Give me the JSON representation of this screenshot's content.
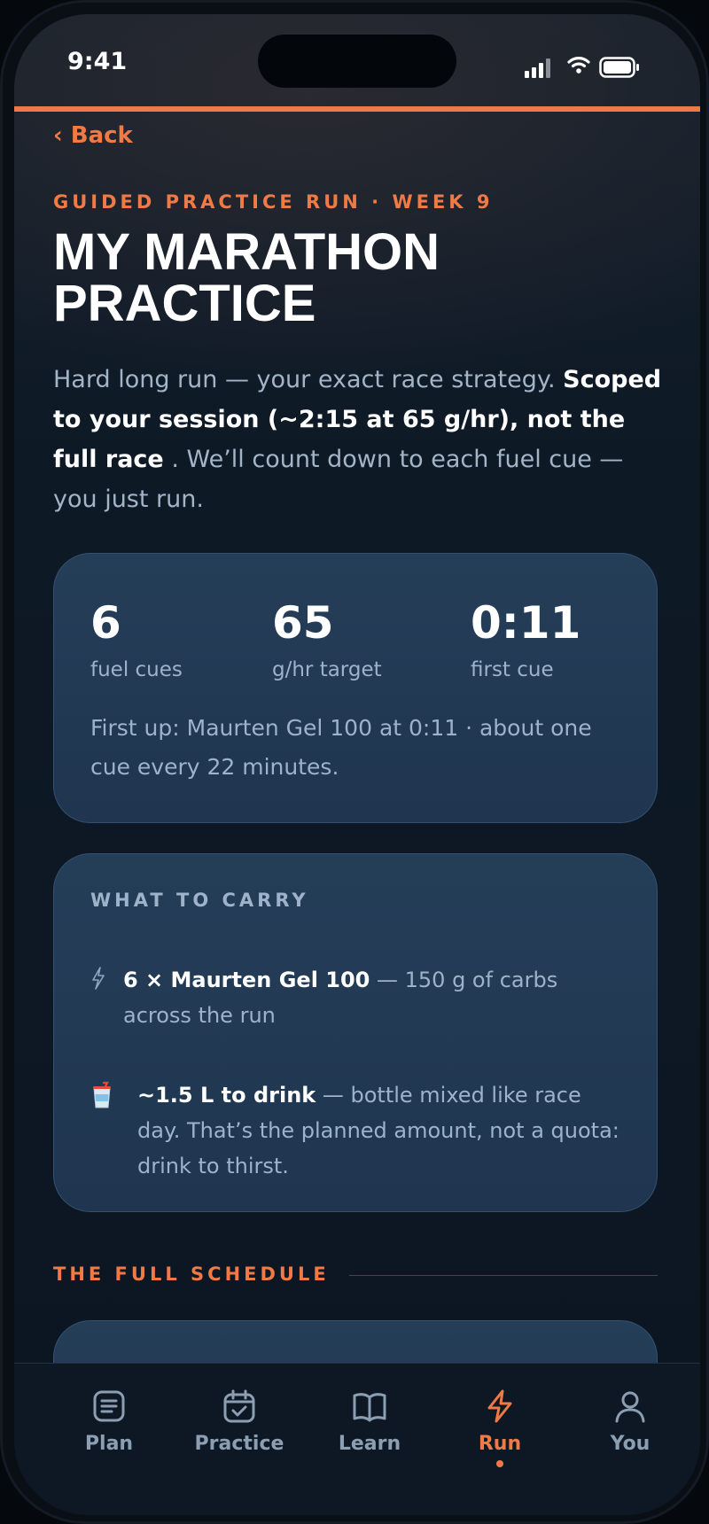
{
  "status_bar": {
    "time": "9:41"
  },
  "nav": {
    "back_label": "‹ Back"
  },
  "header": {
    "eyebrow": "GUIDED PRACTICE RUN · WEEK 9",
    "title": "MY MARATHON PRACTICE",
    "description_intro": "Hard long run — your exact race strategy.",
    "description_bold": "Scoped to your session (~2:15 at 65 g/hr), not the full race",
    "description_outro": ". We’ll count down to each fuel cue — you just run."
  },
  "summary": {
    "stats": [
      {
        "value": "6",
        "label": "fuel cues"
      },
      {
        "value": "65",
        "label": "g/hr target"
      },
      {
        "value": "0:11",
        "label": "first cue"
      }
    ],
    "note": "First up: Maurten Gel 100 at 0:11 · about one cue every 22 minutes."
  },
  "carry": {
    "heading": "WHAT TO CARRY",
    "items": [
      {
        "icon": "lightning-icon",
        "bold": "6 × Maurten Gel 100",
        "text": " — 150 g of carbs across the run"
      },
      {
        "icon": "drink-cup-icon",
        "bold": "~1.5 L to drink",
        "text": " — bottle mixed like race day. That’s the planned amount, not a quota: drink to thirst."
      }
    ]
  },
  "schedule": {
    "heading": "THE FULL SCHEDULE"
  },
  "tabs": [
    {
      "label": "Plan",
      "icon": "document-list-icon",
      "active": false
    },
    {
      "label": "Practice",
      "icon": "calendar-check-icon",
      "active": false
    },
    {
      "label": "Learn",
      "icon": "open-book-icon",
      "active": false
    },
    {
      "label": "Run",
      "icon": "lightning-icon",
      "active": true
    },
    {
      "label": "You",
      "icon": "person-icon",
      "active": false
    }
  ],
  "colors": {
    "accent": "#f07a45",
    "card": "#22395a",
    "background": "#0c1622",
    "muted_text": "#9eb3c9"
  }
}
